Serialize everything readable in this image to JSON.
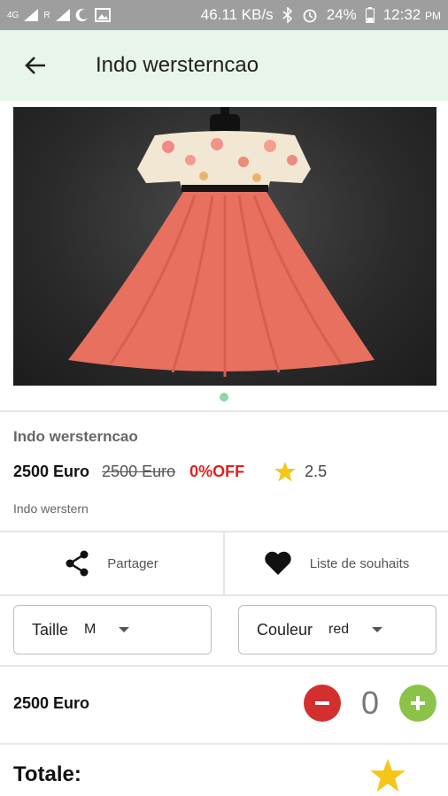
{
  "status_bar": {
    "network": "4G",
    "roaming": "R",
    "speed": "46.11 KB/s",
    "battery": "24%",
    "time": "12:32",
    "ampm": "PM"
  },
  "header": {
    "title": "Indo wersterncao"
  },
  "carousel": {
    "pages": 1,
    "current": 1
  },
  "product": {
    "name": "Indo wersterncao",
    "price": "2500 Euro",
    "old_price": "2500 Euro",
    "discount": "0%OFF",
    "rating": "2.5",
    "description": "Indo werstern"
  },
  "actions": {
    "share_label": "Partager",
    "wishlist_label": "Liste de souhaits"
  },
  "options": {
    "size_label": "Taille",
    "size_value": "M",
    "color_label": "Couleur",
    "color_value": "red"
  },
  "quantity": {
    "price": "2500 Euro",
    "value": "0"
  },
  "total": {
    "label": "Totale:"
  },
  "colors": {
    "app_bar": "#e8f5ea",
    "discount": "#e02020",
    "minus": "#d32f2f",
    "plus": "#8bc34a",
    "star": "#f5c518"
  }
}
